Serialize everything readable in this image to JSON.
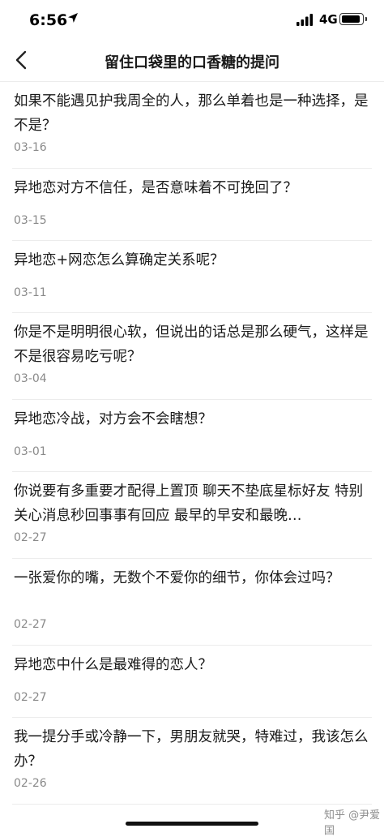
{
  "status_bar": {
    "time": "6:56",
    "network": "4G"
  },
  "nav": {
    "back_icon": "chevron-left-icon",
    "title": "留住口袋里的口香糖的提问"
  },
  "questions": [
    {
      "title": "如果不能遇见护我周全的人，那么单着也是一种选择，是不是？",
      "date": "03-16"
    },
    {
      "title": "异地恋对方不信任，是否意味着不可挽回了？",
      "date": "03-15"
    },
    {
      "title": "异地恋+网恋怎么算确定关系呢？",
      "date": "03-11"
    },
    {
      "title": "你是不是明明很心软，但说出的话总是那么硬气，这样是不是很容易吃亏呢？",
      "date": "03-04"
    },
    {
      "title": "异地恋冷战，对方会不会瞎想？",
      "date": "03-01"
    },
    {
      "title": "你说要有多重要才配得上置顶 聊天不垫底星标好友 特别关心消息秒回事事有回应 最早的早安和最晚…",
      "date": "02-27"
    },
    {
      "title": "一张爱你的嘴，无数个不爱你的细节，你体会过吗？",
      "date": "02-27"
    },
    {
      "title": "异地恋中什么是最难得的恋人？",
      "date": "02-27"
    },
    {
      "title": "我一提分手或冷静一下，男朋友就哭，特难过，我该怎么办？",
      "date": "02-26"
    }
  ],
  "watermark": "知乎 @尹爱国"
}
